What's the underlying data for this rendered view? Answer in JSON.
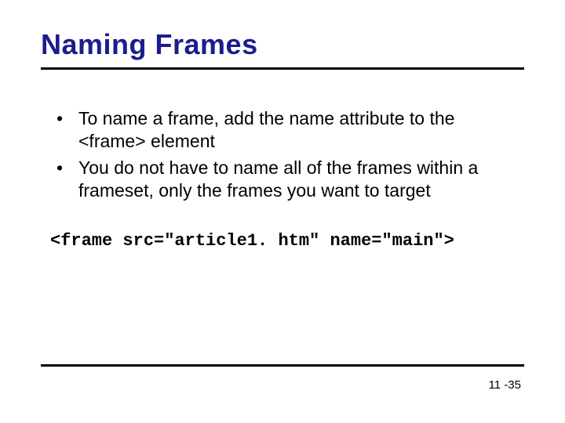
{
  "title": "Naming Frames",
  "bullets": [
    "To name a frame, add the name attribute to the <frame> element",
    "You do not have to name all of the frames within a frameset, only the frames you want to target"
  ],
  "code": "<frame src=\"article1. htm\" name=\"main\">",
  "page_number": "11 -35"
}
